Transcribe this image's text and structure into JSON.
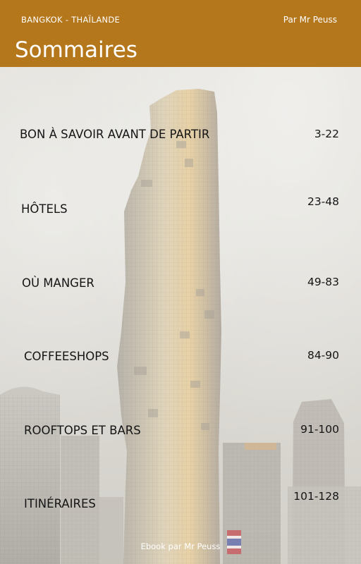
{
  "header": {
    "location": "BANGKOK - THAÏLANDE",
    "author": "Par Mr Peuss",
    "title": "Sommaires"
  },
  "toc": [
    {
      "label": "BON À SAVOIR AVANT DE PARTIR",
      "pages": "3-22"
    },
    {
      "label": "HÔTELS",
      "pages": "23-48"
    },
    {
      "label": "OÙ MANGER",
      "pages": "49-83"
    },
    {
      "label": "COFFEESHOPS",
      "pages": "84-90"
    },
    {
      "label": "ROOFTOPS ET BARS",
      "pages": "91-100"
    },
    {
      "label": "ITINÉRAIRES",
      "pages": "101-128"
    }
  ],
  "footer": {
    "credit": "Ebook par Mr Peuss"
  },
  "colors": {
    "header_bg": "#b5771c",
    "text": "#151515"
  }
}
